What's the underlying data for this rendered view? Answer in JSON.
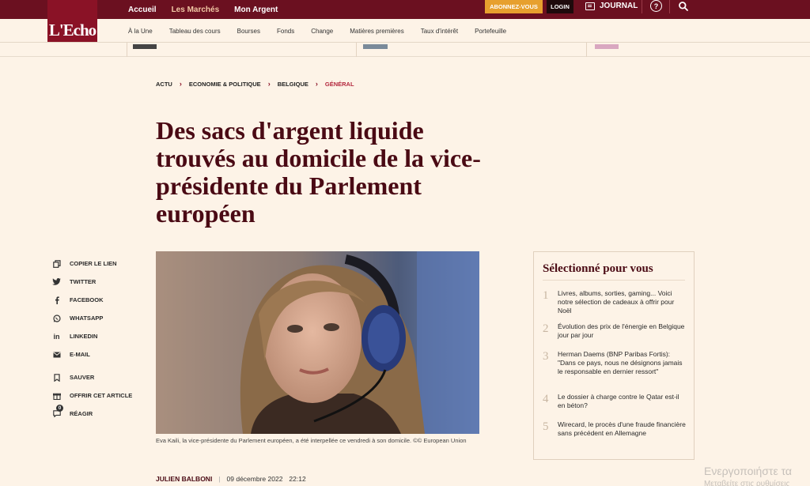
{
  "brand": {
    "logo_text": "L'Echo"
  },
  "topnav": {
    "items": [
      {
        "label": "Accueil"
      },
      {
        "label": "Les Marchés"
      },
      {
        "label": "Mon Argent"
      }
    ],
    "subscribe_label": "ABONNEZ-VOUS",
    "login_label": "LOGIN",
    "journal_label": "JOURNAL",
    "help_label": "?"
  },
  "subnav": {
    "items": [
      {
        "label": "À la Une"
      },
      {
        "label": "Tableau des cours"
      },
      {
        "label": "Bourses"
      },
      {
        "label": "Fonds"
      },
      {
        "label": "Change"
      },
      {
        "label": "Matières premières"
      },
      {
        "label": "Taux d'intérêt"
      },
      {
        "label": "Portefeuille"
      }
    ]
  },
  "breadcrumb": {
    "items": [
      "ACTU",
      "ECONOMIE & POLITIQUE",
      "BELGIQUE",
      "GÉNÉRAL"
    ]
  },
  "article": {
    "headline": "Des sacs d'argent liquide trouvés au domicile de la vice-présidente du Parlement européen",
    "caption": "Eva Kaili, la vice-présidente du Parlement européen, a été interpellée ce vendredi à son domicile. ©© European Union",
    "author": "JULIEN BALBONI",
    "date": "09 décembre 2022",
    "time": "22:12"
  },
  "share": {
    "items": [
      {
        "label": "COPIER LE LIEN",
        "icon": "copy-icon"
      },
      {
        "label": "TWITTER",
        "icon": "twitter-icon"
      },
      {
        "label": "FACEBOOK",
        "icon": "facebook-icon"
      },
      {
        "label": "WHATSAPP",
        "icon": "whatsapp-icon"
      },
      {
        "label": "LINKEDIN",
        "icon": "linkedin-icon"
      },
      {
        "label": "E-MAIL",
        "icon": "mail-icon"
      },
      {
        "label": "SAUVER",
        "icon": "bookmark-icon"
      },
      {
        "label": "OFFRIR CET ARTICLE",
        "icon": "gift-icon"
      },
      {
        "label": "RÉAGIR",
        "icon": "comment-icon",
        "badge": "0"
      }
    ]
  },
  "selected": {
    "title": "Sélectionné pour vous",
    "items": [
      {
        "num": "1",
        "text": "Livres, albums, sorties, gaming... Voici notre sélection de cadeaux à offrir pour Noël"
      },
      {
        "num": "2",
        "text": "Évolution des prix de l'énergie en Belgique jour par jour"
      },
      {
        "num": "3",
        "text": "Herman Daems (BNP Paribas Fortis): \"Dans ce pays, nous ne désignons jamais le responsable en dernier ressort\""
      },
      {
        "num": "4",
        "text": "Le dossier à charge contre le Qatar est-il en béton?"
      },
      {
        "num": "5",
        "text": "Wirecard, le procès d'une fraude financière sans précédent en Allemagne"
      }
    ]
  },
  "os_overlay": {
    "line1": "Ενεργοποιήστε τα",
    "line2": "Μεταβείτε στις ρυθμίσεις"
  },
  "colors": {
    "brand": "#8a1226",
    "topbar": "#6b1020",
    "headline": "#4a0a14",
    "background": "#fdf3e7",
    "subscribe": "#e7a02e"
  }
}
